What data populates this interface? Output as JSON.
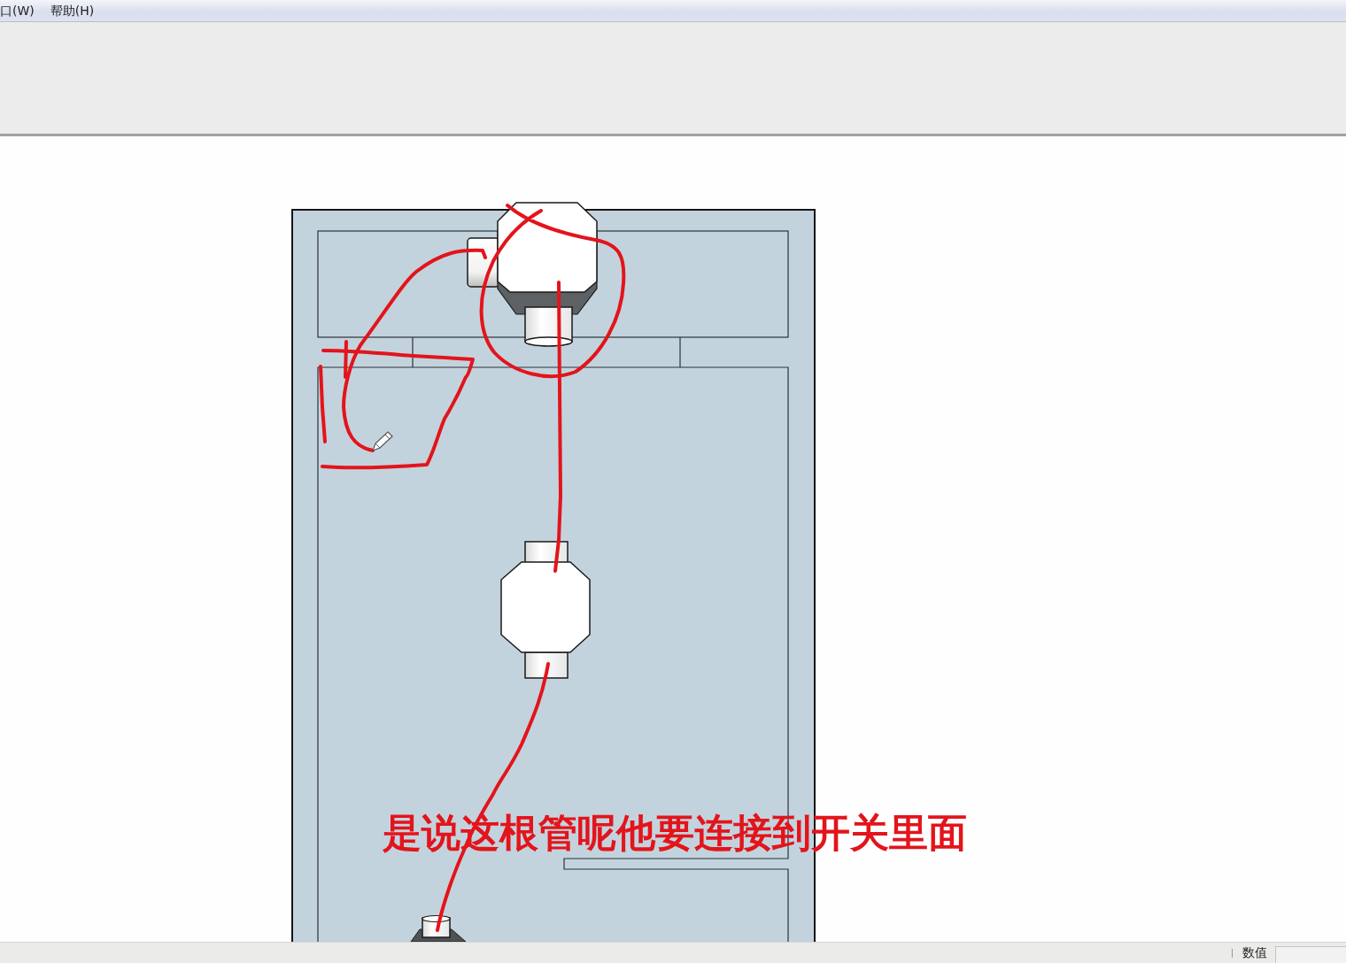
{
  "menu_bar": {
    "items": [
      "口(W)",
      "帮助(H)"
    ]
  },
  "subtitle": "是说这根管呢他要连接到开关里面",
  "status_bar": {
    "label": "数值"
  }
}
